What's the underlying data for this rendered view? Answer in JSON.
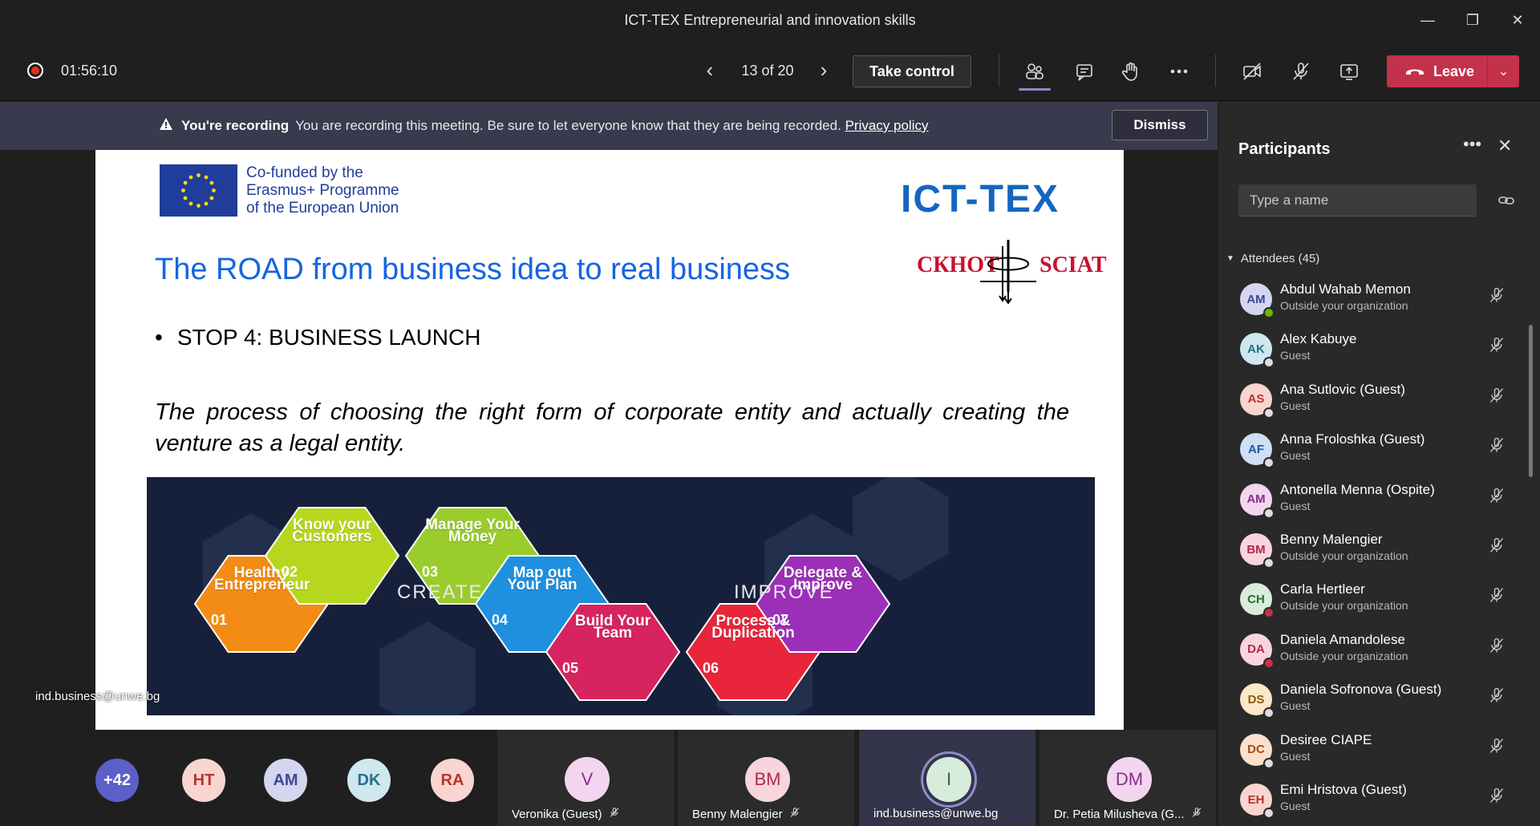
{
  "window": {
    "title": "ICT-TEX Entrepreneurial and innovation skills",
    "controls": [
      "minimize",
      "maximize",
      "close"
    ]
  },
  "toolbar": {
    "timer": "01:56:10",
    "page_count": "13 of 20",
    "take_control_label": "Take control",
    "leave_label": "Leave",
    "icons": [
      "participants-icon",
      "chat-icon",
      "raise-hand-icon",
      "more-icon",
      "camera-off-icon",
      "mic-off-icon",
      "share-icon"
    ]
  },
  "banner": {
    "title": "You're recording",
    "message": "You are recording this meeting. Be sure to let everyone know that they are being recorded.",
    "link": "Privacy policy",
    "dismiss_label": "Dismiss"
  },
  "slide": {
    "cofunded": "Co-funded by the\nErasmus+ Programme\nof the European Union",
    "brand": "ICT-TEX",
    "sciat_left": "СКНОТ",
    "sciat_right": "SCIAT",
    "title": "The ROAD from business idea to real business",
    "bullet": "STOP 4: BUSINESS LAUNCH",
    "description": "The process of choosing the right form of corporate entity and actually creating the venture as a legal entity.",
    "road": {
      "create": "CREATE",
      "improve": "IMPROVE",
      "steps": [
        {
          "num": "01",
          "label": "Healthy Entrepreneur",
          "color": "#f28c14"
        },
        {
          "num": "02",
          "label": "Know your Customers",
          "color": "#b7d71f"
        },
        {
          "num": "03",
          "label": "Manage Your Money",
          "color": "#9acc2c"
        },
        {
          "num": "04",
          "label": "Map out Your Plan",
          "color": "#1f8fe0"
        },
        {
          "num": "05",
          "label": "Build Your Team",
          "color": "#d7245e"
        },
        {
          "num": "06",
          "label": "Process & Duplication",
          "color": "#e8253a"
        },
        {
          "num": "07",
          "label": "Delegate & Improve",
          "color": "#9c2fb8"
        }
      ]
    }
  },
  "email_overlay": "ind.business@unwe.bg",
  "roster": {
    "overflow": "+42",
    "small": [
      {
        "initials": "HT",
        "bg": "#f8d5d0",
        "fg": "#b8342a"
      },
      {
        "initials": "AM",
        "bg": "#d3d6ee",
        "fg": "#3e4694"
      },
      {
        "initials": "DK",
        "bg": "#cfe7ef",
        "fg": "#24708a"
      },
      {
        "initials": "RA",
        "bg": "#f8d5d0",
        "fg": "#b8342a"
      }
    ],
    "tiles": [
      {
        "initials": "V",
        "name": "Veronika (Guest)",
        "bg": "#f2d6ef",
        "fg": "#8a2e86",
        "active": false
      },
      {
        "initials": "BM",
        "name": "Benny Malengier",
        "bg": "#f8d5dd",
        "fg": "#b02a4a",
        "active": false
      },
      {
        "initials": "I",
        "name": "ind.business@unwe.bg",
        "bg": "#d7ecdb",
        "fg": "#2a6b38",
        "active": true
      },
      {
        "initials": "DM",
        "name": "Dr. Petia Milusheva (G...",
        "bg": "#f2d6ef",
        "fg": "#8a2e86",
        "active": false
      }
    ]
  },
  "sidebar": {
    "title": "Participants",
    "search_placeholder": "Type a name",
    "attendees_label": "Attendees (45)",
    "participants": [
      {
        "initials": "AM",
        "name": "Abdul Wahab Memon",
        "sub": "Outside your organization",
        "bg": "#d3d6ee",
        "fg": "#3e4694",
        "status": "#6bb700"
      },
      {
        "initials": "AK",
        "name": "Alex Kabuye",
        "sub": "Guest",
        "bg": "#cfe7ef",
        "fg": "#24708a",
        "status": "#dddddd"
      },
      {
        "initials": "AS",
        "name": "Ana Sutlovic (Guest)",
        "sub": "Guest",
        "bg": "#f8d5d0",
        "fg": "#b8342a",
        "status": "#dddddd"
      },
      {
        "initials": "AF",
        "name": "Anna Froloshka (Guest)",
        "sub": "Guest",
        "bg": "#cfdff5",
        "fg": "#1b5aa8",
        "status": "#dddddd"
      },
      {
        "initials": "AM",
        "name": "Antonella Menna (Ospite)",
        "sub": "Guest",
        "bg": "#f2d6ef",
        "fg": "#8a2e86",
        "status": "#dddddd"
      },
      {
        "initials": "BM",
        "name": "Benny Malengier",
        "sub": "Outside your organization",
        "bg": "#f8d5dd",
        "fg": "#b02a4a",
        "status": "#dddddd"
      },
      {
        "initials": "CH",
        "name": "Carla Hertleer",
        "sub": "Outside your organization",
        "bg": "#d7ecdb",
        "fg": "#2a6b38",
        "status": "#c4314b"
      },
      {
        "initials": "DA",
        "name": "Daniela Amandolese",
        "sub": "Outside your organization",
        "bg": "#f8d5dd",
        "fg": "#b02a4a",
        "status": "#c4314b"
      },
      {
        "initials": "DS",
        "name": "Daniela Sofronova (Guest)",
        "sub": "Guest",
        "bg": "#fbe8c8",
        "fg": "#8a5a10",
        "status": "#dddddd"
      },
      {
        "initials": "DC",
        "name": "Desiree CIAPE",
        "sub": "Guest",
        "bg": "#fbe0cc",
        "fg": "#a34a12",
        "status": "#dddddd"
      },
      {
        "initials": "EH",
        "name": "Emi Hristova (Guest)",
        "sub": "Guest",
        "bg": "#f8d5d0",
        "fg": "#b8342a",
        "status": "#dddddd"
      }
    ]
  }
}
